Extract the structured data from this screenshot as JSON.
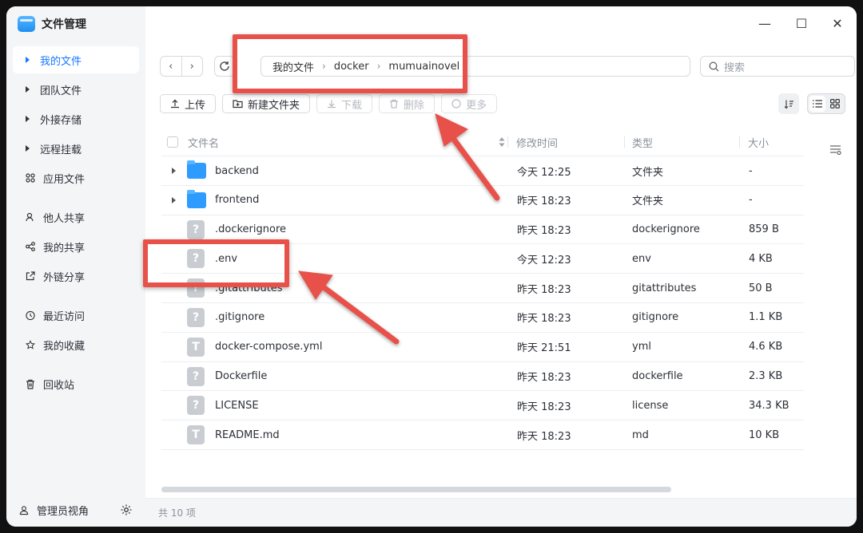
{
  "app": {
    "title": "文件管理"
  },
  "window_controls": {
    "minimize": "—",
    "maximize": "☐",
    "close": "✕"
  },
  "sidebar": {
    "items": [
      {
        "label": "我的文件",
        "icon": "caret-right-icon",
        "active": true
      },
      {
        "label": "团队文件",
        "icon": "caret-right-icon"
      },
      {
        "label": "外接存储",
        "icon": "caret-right-icon"
      },
      {
        "label": "远程挂载",
        "icon": "caret-right-icon"
      },
      {
        "label": "应用文件",
        "icon": "apps-icon"
      },
      {
        "label": "他人共享",
        "icon": "user-share-icon"
      },
      {
        "label": "我的共享",
        "icon": "share-icon"
      },
      {
        "label": "外链分享",
        "icon": "external-link-icon"
      },
      {
        "label": "最近访问",
        "icon": "clock-icon"
      },
      {
        "label": "我的收藏",
        "icon": "star-icon"
      },
      {
        "label": "回收站",
        "icon": "trash-icon"
      }
    ],
    "footer": {
      "label": "管理员视角",
      "icon": "admin-icon",
      "settings_icon": "gear-icon"
    }
  },
  "navigation": {
    "back": "‹",
    "forward": "›"
  },
  "breadcrumb": [
    "我的文件",
    "docker",
    "mumuainovel"
  ],
  "search": {
    "placeholder": "搜索"
  },
  "actions": {
    "upload": "上传",
    "new_folder": "新建文件夹",
    "download": "下载",
    "delete": "删除",
    "more": "更多"
  },
  "table": {
    "headers": {
      "name": "文件名",
      "modified": "修改时间",
      "type": "类型",
      "size": "大小"
    },
    "rows": [
      {
        "name": "backend",
        "modified": "今天 12:25",
        "type": "文件夹",
        "size": "-",
        "kind": "folder",
        "icon": "folder-icon"
      },
      {
        "name": "frontend",
        "modified": "昨天 18:23",
        "type": "文件夹",
        "size": "-",
        "kind": "folder",
        "icon": "folder-icon"
      },
      {
        "name": ".dockerignore",
        "modified": "昨天 18:23",
        "type": "dockerignore",
        "size": "859 B",
        "kind": "unknown",
        "icon": "unknown-file-icon"
      },
      {
        "name": ".env",
        "modified": "今天 12:23",
        "type": "env",
        "size": "4 KB",
        "kind": "unknown",
        "icon": "unknown-file-icon"
      },
      {
        "name": ".gitattributes",
        "modified": "昨天 18:23",
        "type": "gitattributes",
        "size": "50 B",
        "kind": "unknown",
        "icon": "unknown-file-icon"
      },
      {
        "name": ".gitignore",
        "modified": "昨天 18:23",
        "type": "gitignore",
        "size": "1.1 KB",
        "kind": "unknown",
        "icon": "unknown-file-icon"
      },
      {
        "name": "docker-compose.yml",
        "modified": "昨天 21:51",
        "type": "yml",
        "size": "4.6 KB",
        "kind": "text",
        "icon": "text-file-icon"
      },
      {
        "name": "Dockerfile",
        "modified": "昨天 18:23",
        "type": "dockerfile",
        "size": "2.3 KB",
        "kind": "unknown",
        "icon": "unknown-file-icon"
      },
      {
        "name": "LICENSE",
        "modified": "昨天 18:23",
        "type": "license",
        "size": "34.3 KB",
        "kind": "unknown",
        "icon": "unknown-file-icon"
      },
      {
        "name": "README.md",
        "modified": "昨天 18:23",
        "type": "md",
        "size": "10 KB",
        "kind": "text",
        "icon": "text-file-icon"
      }
    ]
  },
  "status": {
    "count_text": "共 10 项"
  },
  "colors": {
    "accent": "#1677ff",
    "annotation": "#e8514a",
    "folder": "#2e9bff",
    "file_icon": "#c9cdd2"
  }
}
